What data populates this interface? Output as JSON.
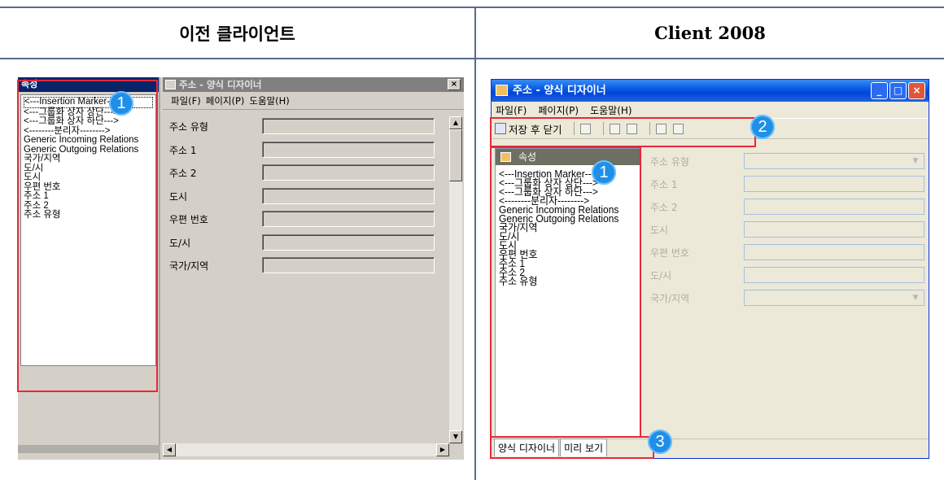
{
  "header": {
    "left_title": "이전 클라이언트",
    "right_title": "Client 2008"
  },
  "old_client": {
    "properties_title": "속성",
    "properties_items": [
      "<---Insertion Marker--->",
      "<---그룹화 상자 상단--->",
      "<---그룹화 상자 하단--->",
      "<--------분리자-------->",
      "Generic Incoming Relations",
      "Generic Outgoing Relations",
      "국가/지역",
      "도/시",
      "도시",
      "우편 번호",
      "주소 1",
      "주소 2",
      "주소 유형"
    ],
    "window_title": "주소 - 양식 디자이너",
    "close_glyph": "×",
    "menu": [
      "파일(F)",
      "페이지(P)",
      "도움말(H)"
    ],
    "fields": [
      "주소 유형",
      "주소 1",
      "주소 2",
      "도시",
      "우편 번호",
      "도/시",
      "국가/지역"
    ],
    "scroll": {
      "up": "▲",
      "down": "▼",
      "left": "◀",
      "right": "▶"
    }
  },
  "new_client": {
    "window_title": "주소 - 양식 디자이너",
    "title_buttons": {
      "minimize": "_",
      "maximize": "□",
      "close": "×"
    },
    "menu": [
      "파일(F)",
      "페이지(P)",
      "도움말(H)"
    ],
    "toolbar_save": "저장 후 닫기",
    "properties_title": "속성",
    "properties_items": [
      "<---Insertion Marker--->",
      "<---그룹화 상자 상단--->",
      "<---그룹화 상자 하단--->",
      "<--------분리자-------->",
      "Generic Incoming Relations",
      "Generic Outgoing Relations",
      "국가/지역",
      "도/시",
      "도시",
      "우편 번호",
      "주소 1",
      "주소 2",
      "주소 유형"
    ],
    "fields": [
      "주소 유형",
      "주소 1",
      "주소 2",
      "도시",
      "우편 번호",
      "도/시",
      "국가/지역"
    ],
    "dropdown_arrow": "▼",
    "tabs": [
      "양식 디자이너",
      "미리 보기"
    ]
  },
  "callouts": [
    "1",
    "1",
    "2",
    "3"
  ],
  "colors": {
    "callout_border": "#e8283a",
    "badge": "#1f8fe8",
    "xp_title": "#0a5ce6",
    "classic_title": "#0a246a"
  }
}
